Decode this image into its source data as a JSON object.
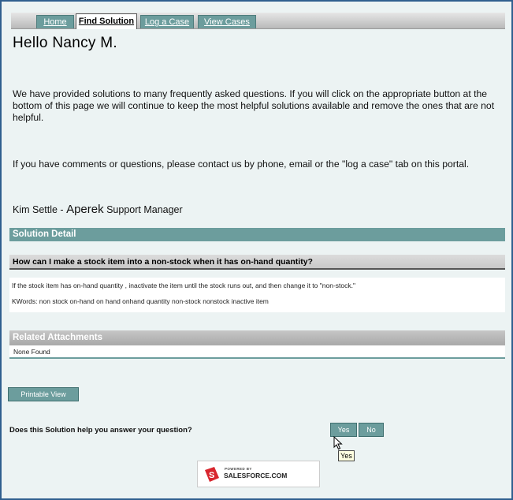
{
  "tabs": [
    {
      "label": "Home",
      "active": false
    },
    {
      "label": "Find Solution",
      "active": true
    },
    {
      "label": "Log a Case",
      "active": false
    },
    {
      "label": "View Cases",
      "active": false
    }
  ],
  "greeting": "Hello Nancy M.",
  "intro_paragraph": "We have provided solutions to many frequently asked questions. If you will click on the appropriate button at the bottom of this page we will continue to keep the most helpful solutions available and remove the ones that are not helpful.",
  "contact_paragraph": "If you have comments or questions, please contact us by phone, email or the \"log a case\" tab on this portal.",
  "signature": {
    "name": "Kim Settle - ",
    "company": "Aperek",
    "role": " Support Manager"
  },
  "solution_detail": {
    "header": "Solution Detail",
    "question": "How can I make a stock item into a non-stock when it has on-hand quantity?",
    "answer": "If the stock item has on-hand quantity , inactivate the item until the stock runs out, and then change it to \"non-stock.\"",
    "keywords": "KWords: non stock on-hand on hand onhand quantity non-stock nonstock inactive item"
  },
  "attachments": {
    "header": "Related Attachments",
    "empty_text": "None Found"
  },
  "buttons": {
    "printable_view": "Printable View",
    "yes": "Yes",
    "no": "No"
  },
  "feedback_prompt": "Does this Solution help you answer your question?",
  "tooltip_text": "Yes",
  "footer": {
    "powered_by": "POWERED BY",
    "brand": "SALESFORCE.COM",
    "logo_letter": "S"
  },
  "colors": {
    "accent": "#6c9d9d",
    "background": "#ecf3f3",
    "frame_border": "#2f5f8f",
    "logo_red": "#d8262e"
  }
}
